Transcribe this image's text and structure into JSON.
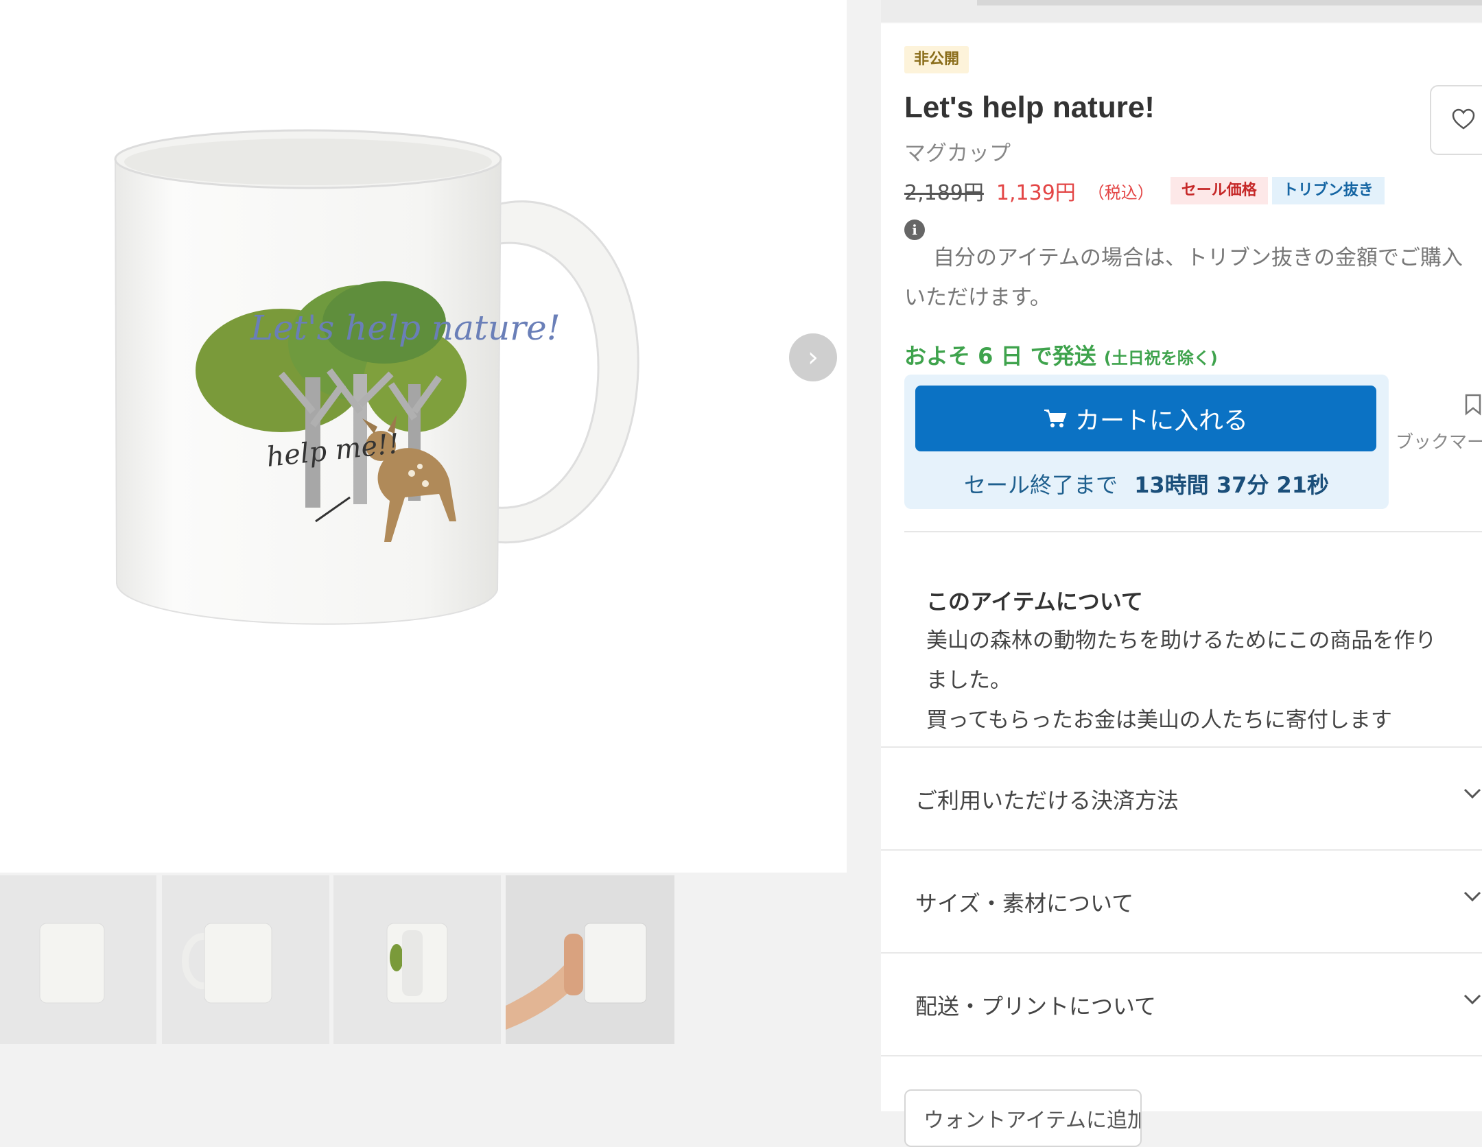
{
  "gallery": {
    "next_icon": "chevron-right-icon",
    "mug_print_text": "Let's help nature!",
    "mug_print_subtext": "help me!!",
    "thumbnails": [
      "mug-front-plain",
      "mug-side-plain",
      "mug-handle-side",
      "mug-in-hand"
    ]
  },
  "product": {
    "status_badge": "非公開",
    "title": "Let's help nature!",
    "category": "マグカップ",
    "favorite_icon": "heart-icon",
    "price": {
      "original": "2,189円",
      "sale": "1,139円",
      "tax_note": "（税込）",
      "sale_badge": "セール価格",
      "tribun_badge": "トリブン抜き"
    },
    "info_icon": "info-icon",
    "info_line1": "自分のアイテムの場合は、トリブン抜きの金額でご購入",
    "info_line2": "いただけます。",
    "shipping": "およそ 6 日 で発送",
    "shipping_note": "(土日祝を除く)",
    "cart_button": "カートに入れる",
    "cart_icon": "cart-icon",
    "countdown_label": "セール終了まで",
    "countdown_time": "13時間 37分 21秒",
    "bookmark_label": "ブックマーク",
    "bookmark_icon": "bookmark-icon"
  },
  "about": {
    "heading": "このアイテムについて",
    "line1": "美山の森林の動物たちを助けるためにこの商品を作り",
    "line2": "ました。",
    "line3": "買ってもらったお金は美山の人たちに寄付します"
  },
  "accordions": [
    "ご利用いただける決済方法",
    "サイズ・素材について",
    "配送・プリントについて"
  ],
  "bottom_button": "ウォントアイテムに追加",
  "colors": {
    "primary": "#0b72c4",
    "sale_red": "#e34545",
    "shipping_green": "#3fa34d",
    "countdown_bg": "#e6f2fb"
  }
}
